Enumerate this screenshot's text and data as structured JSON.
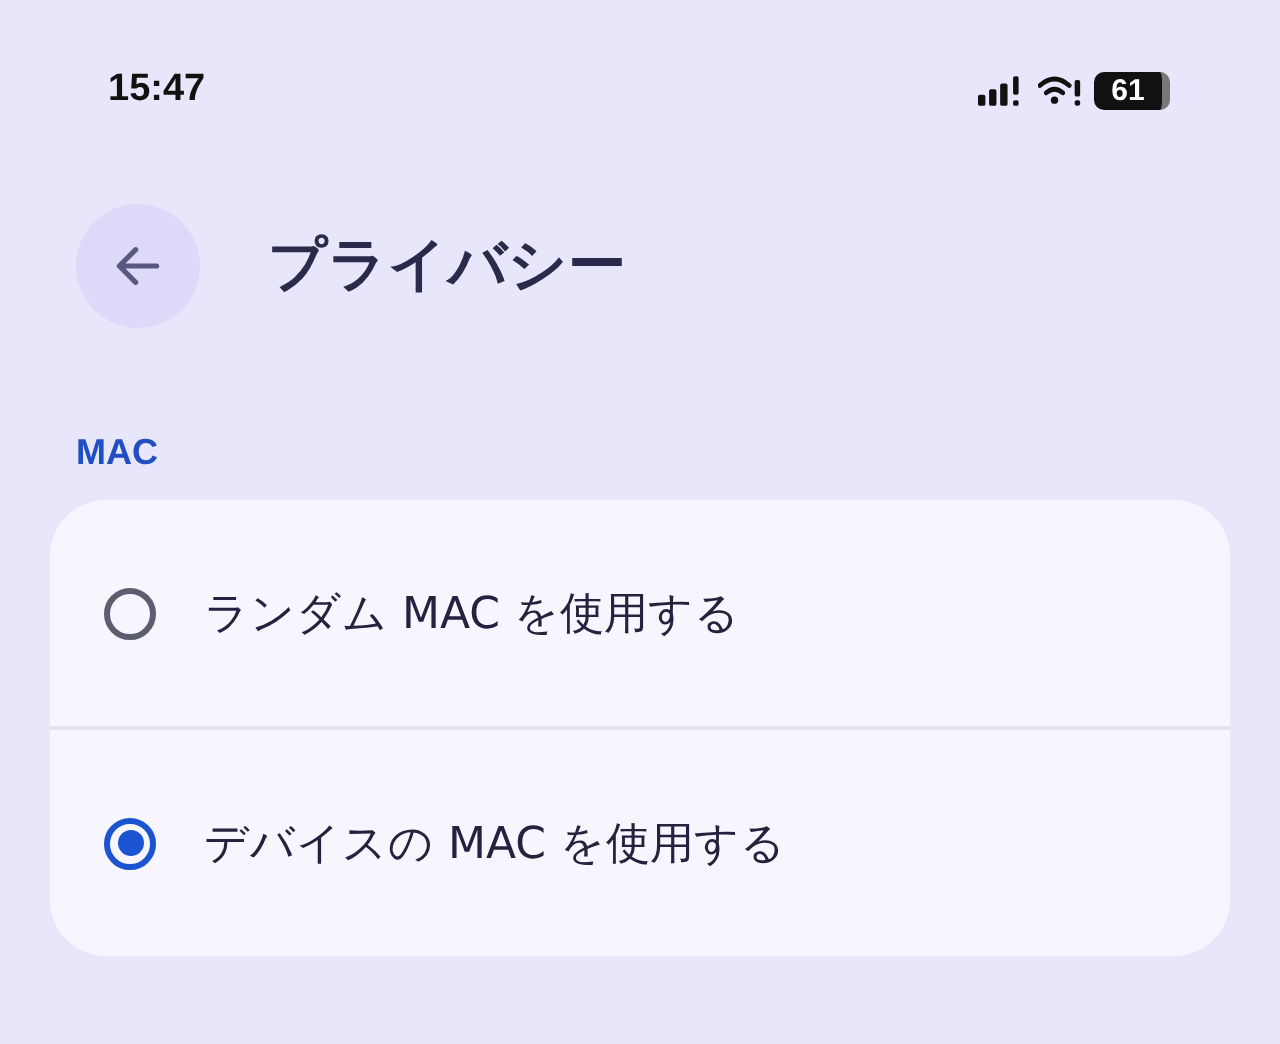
{
  "status_bar": {
    "time": "15:47",
    "battery": "61"
  },
  "header": {
    "title": "プライバシー"
  },
  "section": {
    "heading": "MAC",
    "options": [
      {
        "label": "ランダム MAC を使用する",
        "selected": false
      },
      {
        "label": "デバイスの MAC を使用する",
        "selected": true
      }
    ]
  }
}
